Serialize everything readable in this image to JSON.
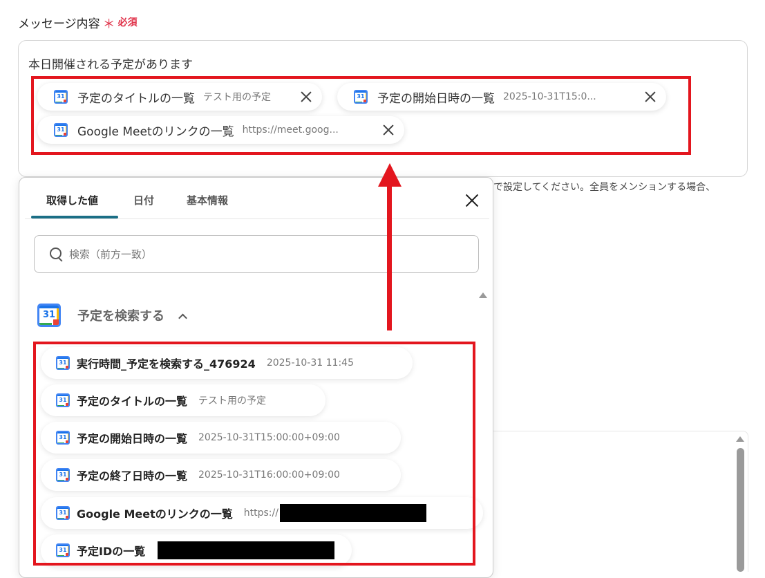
{
  "field": {
    "label": "メッセージ内容",
    "required_mark": "＊",
    "required_text": "必須"
  },
  "message": {
    "text": "本日開催される予定があります",
    "chips": [
      {
        "name": "予定のタイトルの一覧",
        "value": "テスト用の予定"
      },
      {
        "name": "予定の開始日時の一覧",
        "value": "2025-10-31T15:0..."
      },
      {
        "name": "Google Meetのリンクの一覧",
        "value": "https://meet.goog..."
      }
    ]
  },
  "helper_text": "で設定してください。全員をメンションする場合、",
  "panel": {
    "tabs": [
      "取得した値",
      "日付",
      "基本情報"
    ],
    "active_tab": "取得した値",
    "search_placeholder": "検索（前方一致）",
    "section": {
      "title": "予定を検索する",
      "icon_day": "31"
    },
    "items": [
      {
        "name": "実行時間_予定を検索する_476924",
        "value": "2025-10-31 11:45"
      },
      {
        "name": "予定のタイトルの一覧",
        "value": "テスト用の予定"
      },
      {
        "name": "予定の開始日時の一覧",
        "value": "2025-10-31T15:00:00+09:00"
      },
      {
        "name": "予定の終了日時の一覧",
        "value": "2025-10-31T16:00:00+09:00"
      },
      {
        "name": "Google Meetのリンクの一覧",
        "value": "https://"
      },
      {
        "name": "予定IDの一覧",
        "value": ""
      }
    ]
  },
  "icons": {
    "calendar": "google-calendar-icon",
    "close": "close-icon",
    "search": "search-icon",
    "chevron": "chevron-up-icon"
  },
  "colors": {
    "highlight": "#e3161e",
    "tab_active": "#1b6f86",
    "required": "#e0334a"
  }
}
